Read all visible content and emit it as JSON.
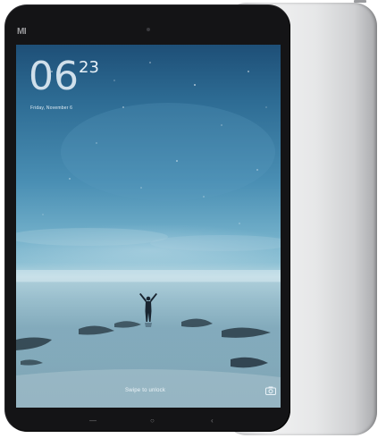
{
  "device": {
    "brand_logo": "MI",
    "lock_screen": {
      "clock_hour": "06",
      "clock_minutes": "23",
      "date_text": "Friday, November 6",
      "unlock_hint": "Swipe to unlock"
    },
    "icons": {
      "camera_shortcut": "camera-icon",
      "front_camera": "front-camera-icon",
      "menu_key": "menu-key-icon",
      "home_key": "home-key-icon",
      "back_key": "back-key-icon"
    },
    "colors": {
      "bezel": "#141416",
      "back_shell": "#e6e7e8",
      "sky_top": "#1e4f77",
      "horizon": "#b6d5df"
    }
  }
}
